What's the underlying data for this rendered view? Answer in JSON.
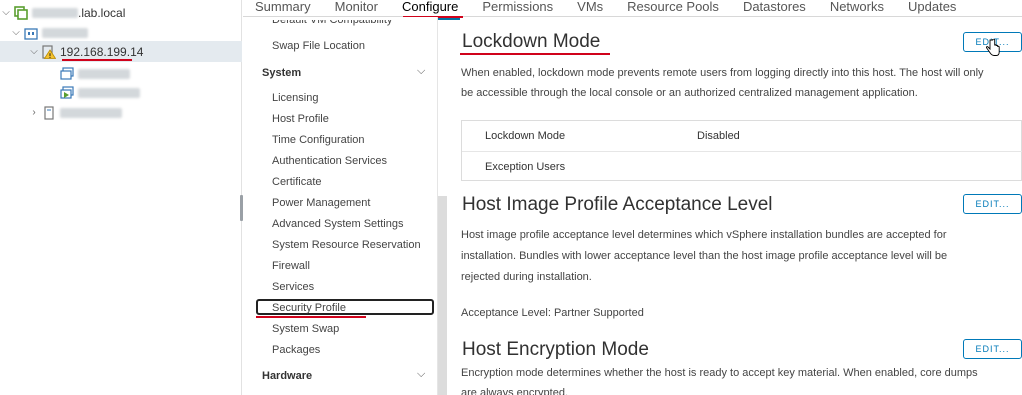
{
  "tree": {
    "root": {
      "label": ".lab.local"
    },
    "host": {
      "label": "192.168.199.14"
    }
  },
  "tabs": [
    "Summary",
    "Monitor",
    "Configure",
    "Permissions",
    "VMs",
    "Resource Pools",
    "Datastores",
    "Networks",
    "Updates"
  ],
  "active_tab": "Configure",
  "nav": {
    "cut_item": "Default VM Compatibility",
    "swap_item": "Swap File Location",
    "system_group": "System",
    "items": [
      "Licensing",
      "Host Profile",
      "Time Configuration",
      "Authentication Services",
      "Certificate",
      "Power Management",
      "Advanced System Settings",
      "System Resource Reservation",
      "Firewall",
      "Services",
      "Security Profile",
      "System Swap",
      "Packages"
    ],
    "hardware_group": "Hardware"
  },
  "lockdown": {
    "title": "Lockdown Mode",
    "edit": "EDIT...",
    "desc1": "When enabled, lockdown mode prevents remote users from logging directly into this host. The host will only",
    "desc2": "be accessible through the local console or an authorized centralized management application.",
    "rows": [
      {
        "key": "Lockdown Mode",
        "value": "Disabled"
      },
      {
        "key": "Exception Users",
        "value": ""
      }
    ]
  },
  "image_profile": {
    "title": "Host Image Profile Acceptance Level",
    "edit": "EDIT...",
    "desc1": "Host image profile acceptance level determines which vSphere installation bundles are accepted for",
    "desc2": "installation. Bundles with lower acceptance level than the host image profile acceptance level will be",
    "desc3": "rejected during installation.",
    "level": "Acceptance Level: Partner Supported"
  },
  "encryption": {
    "title": "Host Encryption Mode",
    "edit": "EDIT...",
    "desc1": "Encryption mode determines whether the host is ready to accept key material. When enabled, core dumps",
    "desc2": "are always encrypted."
  }
}
